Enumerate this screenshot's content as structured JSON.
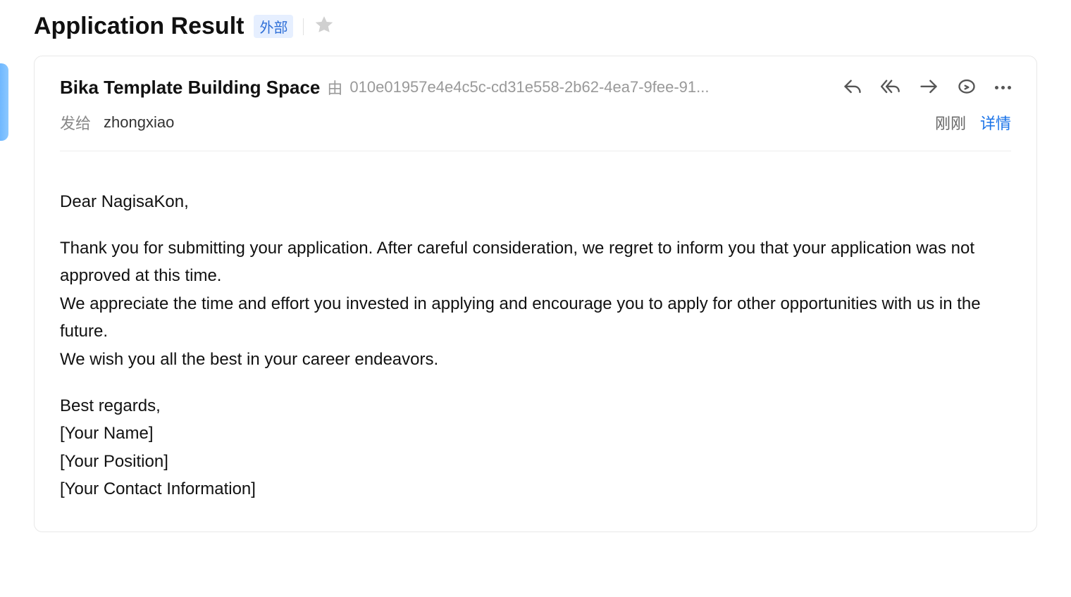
{
  "header": {
    "subject": "Application Result",
    "external_badge": "外部"
  },
  "message": {
    "sender_name": "Bika Template Building Space",
    "via_label": "由",
    "via_address": "010e01957e4e4c5c-cd31e558-2b62-4ea7-9fee-91...",
    "to_label": "发给",
    "to_value": "zhongxiao",
    "time_label": "刚刚",
    "details_link": "详情"
  },
  "body": {
    "greeting": "Dear NagisaKon,",
    "p1": "Thank you for submitting your application. After careful consideration, we regret to inform you that your application was not approved at this time.",
    "p2": "We appreciate the time and effort you invested in applying and encourage you to apply for other opportunities with us in the future.",
    "p3": "We wish you all the best in your career endeavors.",
    "signoff": "Best regards,",
    "name_ph": "[Your Name]",
    "position_ph": "[Your Position]",
    "contact_ph": "[Your Contact Information]"
  }
}
